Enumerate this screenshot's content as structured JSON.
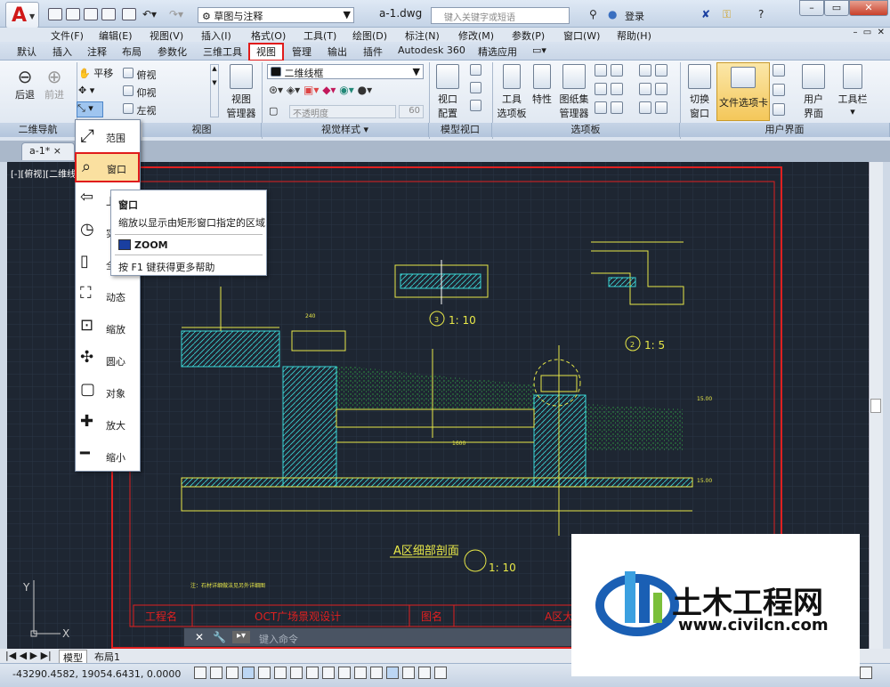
{
  "titlebar": {
    "workspace": "草图与注释",
    "document": "a-1.dwg",
    "search_placeholder": "键入关键字或短语",
    "login": "登录"
  },
  "menubar": {
    "items": [
      "文件(F)",
      "编辑(E)",
      "视图(V)",
      "插入(I)",
      "格式(O)",
      "工具(T)",
      "绘图(D)",
      "标注(N)",
      "修改(M)",
      "参数(P)",
      "窗口(W)",
      "帮助(H)"
    ]
  },
  "ribbon_tabs": [
    "默认",
    "插入",
    "注释",
    "布局",
    "参数化",
    "三维工具",
    "视图",
    "管理",
    "输出",
    "插件",
    "Autodesk 360",
    "精选应用"
  ],
  "ribbon": {
    "nav": {
      "back": "后退",
      "forward": "前进",
      "pan": "平移"
    },
    "views": [
      "俯视",
      "仰视",
      "左视"
    ],
    "view_manager": "视图\n管理器",
    "visual_style": "二维线框",
    "opacity_placeholder": "不透明度",
    "opacity_value": "60",
    "viewport_config": "视口\n配置",
    "tool_palette": "工具\n选项板",
    "properties": "特性",
    "sheetset": "图纸集\n管理器",
    "switch_window": "切换\n窗口",
    "file_tabs": "文件选项卡",
    "user_interface": "用户\n界面",
    "toolbars": "工具栏",
    "panels": {
      "nav2d": "二维导航",
      "view": "视图",
      "visual_styles": "视觉样式",
      "model_viewport": "模型视口",
      "palettes": "选项板",
      "ui": "用户界面"
    }
  },
  "doc_tab": "a-1*",
  "view_label": "[-][俯视][二维线",
  "zoom_menu": [
    "范围",
    "窗口",
    "上",
    "实",
    "全",
    "动态",
    "缩放",
    "圆心",
    "对象",
    "放大",
    "缩小"
  ],
  "tooltip": {
    "title": "窗口",
    "desc": "缩放以显示由矩形窗口指定的区域",
    "cmd": "ZOOM",
    "help": "按 F1 键获得更多帮助"
  },
  "drawing": {
    "section_title": "A区细部剖面",
    "scale1": "1: 10",
    "scale2": "1: 10",
    "scale3": "1: 5",
    "note": "注：石材详细做法见另外详细图",
    "dim_main": "1600",
    "dim_top": "240",
    "mark_circle": "3",
    "mark_circle2": "2",
    "label_right": "15.00",
    "label_right2": "15.00",
    "titleblock": {
      "project_label": "工程名",
      "project_name": "OCT广场景观设计",
      "drawing_label": "图名",
      "drawing_name": "A区大"
    }
  },
  "cmdline_placeholder": "键入命令",
  "layout_tabs": [
    "模型",
    "布局1"
  ],
  "coords": "-43290.4582, 19054.6431, 0.0000",
  "watermark": {
    "title": "土木工程网",
    "url": "www.civilcn.com"
  }
}
